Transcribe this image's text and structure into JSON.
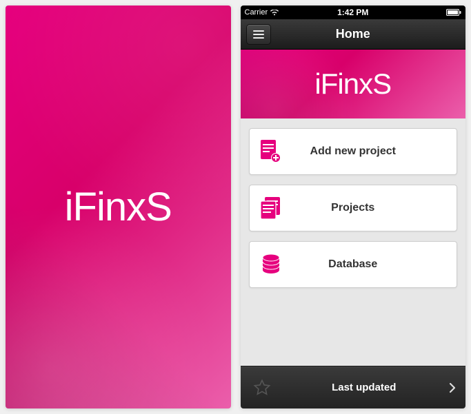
{
  "splash": {
    "brand": "iFinxS"
  },
  "status": {
    "carrier": "Carrier",
    "time": "1:42 PM"
  },
  "nav": {
    "title": "Home"
  },
  "banner": {
    "brand": "iFinxS"
  },
  "menu": {
    "items": [
      {
        "icon": "document-plus-icon",
        "label": "Add new project"
      },
      {
        "icon": "documents-icon",
        "label": "Projects"
      },
      {
        "icon": "database-icon",
        "label": "Database"
      }
    ]
  },
  "footer": {
    "label": "Last updated"
  },
  "colors": {
    "accent": "#e6007e"
  }
}
